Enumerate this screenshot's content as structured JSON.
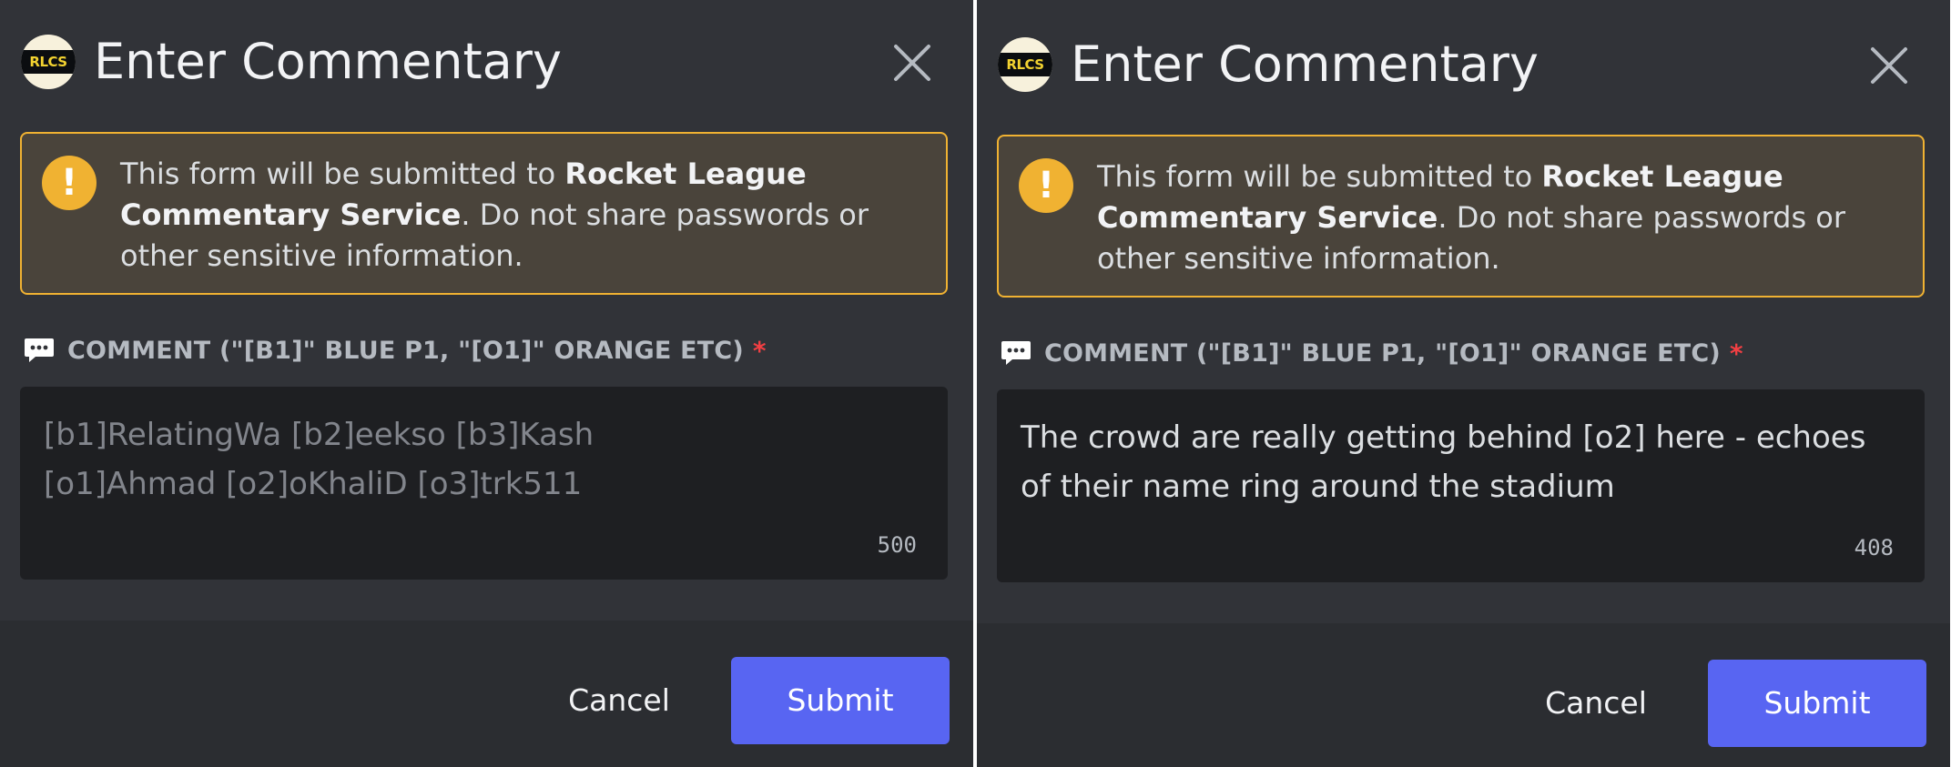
{
  "modals": [
    {
      "logo_text": "RLCS",
      "title": "Enter Commentary",
      "notice": {
        "prefix": "This form will be submitted to ",
        "service": "Rocket League Commentary Service",
        "suffix": ". Do not share passwords or other sensitive information."
      },
      "field": {
        "label": "COMMENT (\"[B1]\" BLUE P1, \"[O1]\" ORANGE ETC)",
        "required_marker": "*",
        "placeholder": "[b1]RelatingWa [b2]eekso [b3]Kash\n[o1]Ahmad [o2]oKhaliD [o3]trk511",
        "value": "",
        "counter": "500"
      },
      "buttons": {
        "cancel": "Cancel",
        "submit": "Submit"
      }
    },
    {
      "logo_text": "RLCS",
      "title": "Enter Commentary",
      "notice": {
        "prefix": "This form will be submitted to ",
        "service": "Rocket League Commentary Service",
        "suffix": ". Do not share passwords or other sensitive information."
      },
      "field": {
        "label": "COMMENT (\"[B1]\" BLUE P1, \"[O1]\" ORANGE ETC)",
        "required_marker": "*",
        "placeholder": "",
        "value": "The crowd are really getting behind [o2] here - echoes\nof their name ring around the stadium",
        "counter": "408"
      },
      "buttons": {
        "cancel": "Cancel",
        "submit": "Submit"
      }
    }
  ],
  "colors": {
    "background": "#313338",
    "footer": "#2b2d31",
    "warning": "#f0b232",
    "required": "#f23f43",
    "submit": "#5865f2",
    "input": "#1e1f22"
  },
  "icons": [
    "rlcs-logo-icon",
    "close-icon",
    "warning-icon",
    "chat-bubble-icon"
  ]
}
